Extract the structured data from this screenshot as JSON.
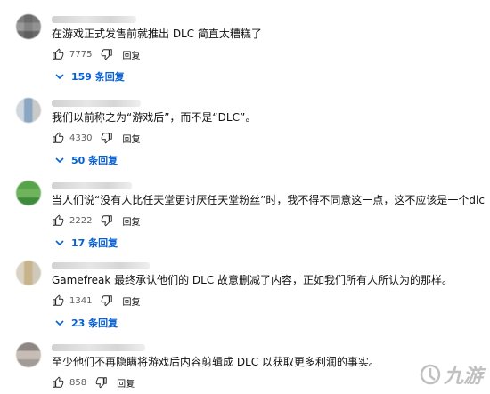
{
  "comments": [
    {
      "text": "在游戏正式发售前就推出 DLC 简直太糟糕了",
      "likes": "7775",
      "reply_label": "回复",
      "replies_label": "159 条回复"
    },
    {
      "text": "我们以前称之为“游戏后”，而不是“DLC”。",
      "likes": "4330",
      "reply_label": "回复",
      "replies_label": "50 条回复"
    },
    {
      "text": "当人们说“没有人比任天堂更讨厌任天堂粉丝”时，我不得不同意这一点，这不应该是一个dlc",
      "likes": "2222",
      "reply_label": "回复",
      "replies_label": "17 条回复"
    },
    {
      "text": "Gamefreak 最终承认他们的 DLC 故意删减了内容，正如我们所有人所认为的那样。",
      "likes": "1341",
      "reply_label": "回复",
      "replies_label": "23 条回复"
    },
    {
      "text": "至少他们不再隐瞒将游戏后内容剪辑成 DLC 以获取更多利润的事实。",
      "likes": "858",
      "reply_label": "回复"
    }
  ],
  "watermark": {
    "text": "九游"
  },
  "colors": {
    "link": "#065fd4",
    "meta": "#606060"
  }
}
